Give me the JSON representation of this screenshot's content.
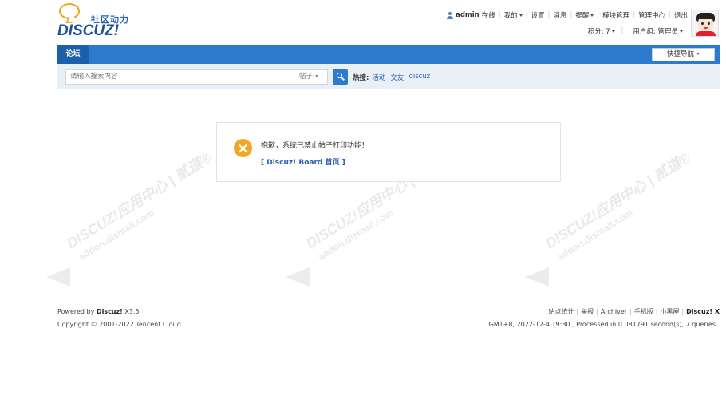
{
  "logo": {
    "cn_text": "社区动力",
    "en_text": "DISCUZ!"
  },
  "userbar": {
    "username": "admin",
    "online": "在线",
    "mine": "我的",
    "settings": "设置",
    "messages": "消息",
    "reminders": "提醒",
    "module_manage": "模块管理",
    "admin_center": "管理中心",
    "logout": "退出",
    "points": "积分: 7",
    "usergroup": "用户组: 管理员"
  },
  "nav": {
    "forum_tab": "论坛",
    "quick_nav": "快捷导航"
  },
  "search": {
    "placeholder": "请输入搜索内容",
    "type": "帖子",
    "hot_label": "热搜:",
    "hot_keywords": [
      "活动",
      "交友",
      "discuz"
    ]
  },
  "message": {
    "text": "抱歉，系统已禁止帖子打印功能！",
    "link": "[ Discuz! Board 首页 ]"
  },
  "footer": {
    "powered_prefix": "Powered by",
    "powered_brand": "Discuz!",
    "version": "X3.5",
    "copyright": "Copyright © 2001-2022 Tencent Cloud.",
    "links": [
      "站点统计",
      "举报",
      "Archiver",
      "手机版",
      "小黑屋"
    ],
    "brand": "Discuz! X",
    "status": "GMT+8, 2022-12-4 19:30 , Processed in 0.081791 second(s), 7 queries ."
  },
  "watermarks": [
    {
      "line1": "DISCUZ!应用中心 | 贰道®",
      "line2": "addon.dismall.com"
    },
    {
      "line1": "DISCUZ!应用中心 | 贰道®",
      "line2": "addon.dismall.com"
    },
    {
      "line1": "DISCUZ!应用中心 | 贰道®",
      "line2": "addon.dismall.com"
    }
  ],
  "colors": {
    "accent": "#2b7acd",
    "accent_dark": "#1c5fab",
    "warning": "#f3a72a",
    "link": "#2a62b8"
  }
}
